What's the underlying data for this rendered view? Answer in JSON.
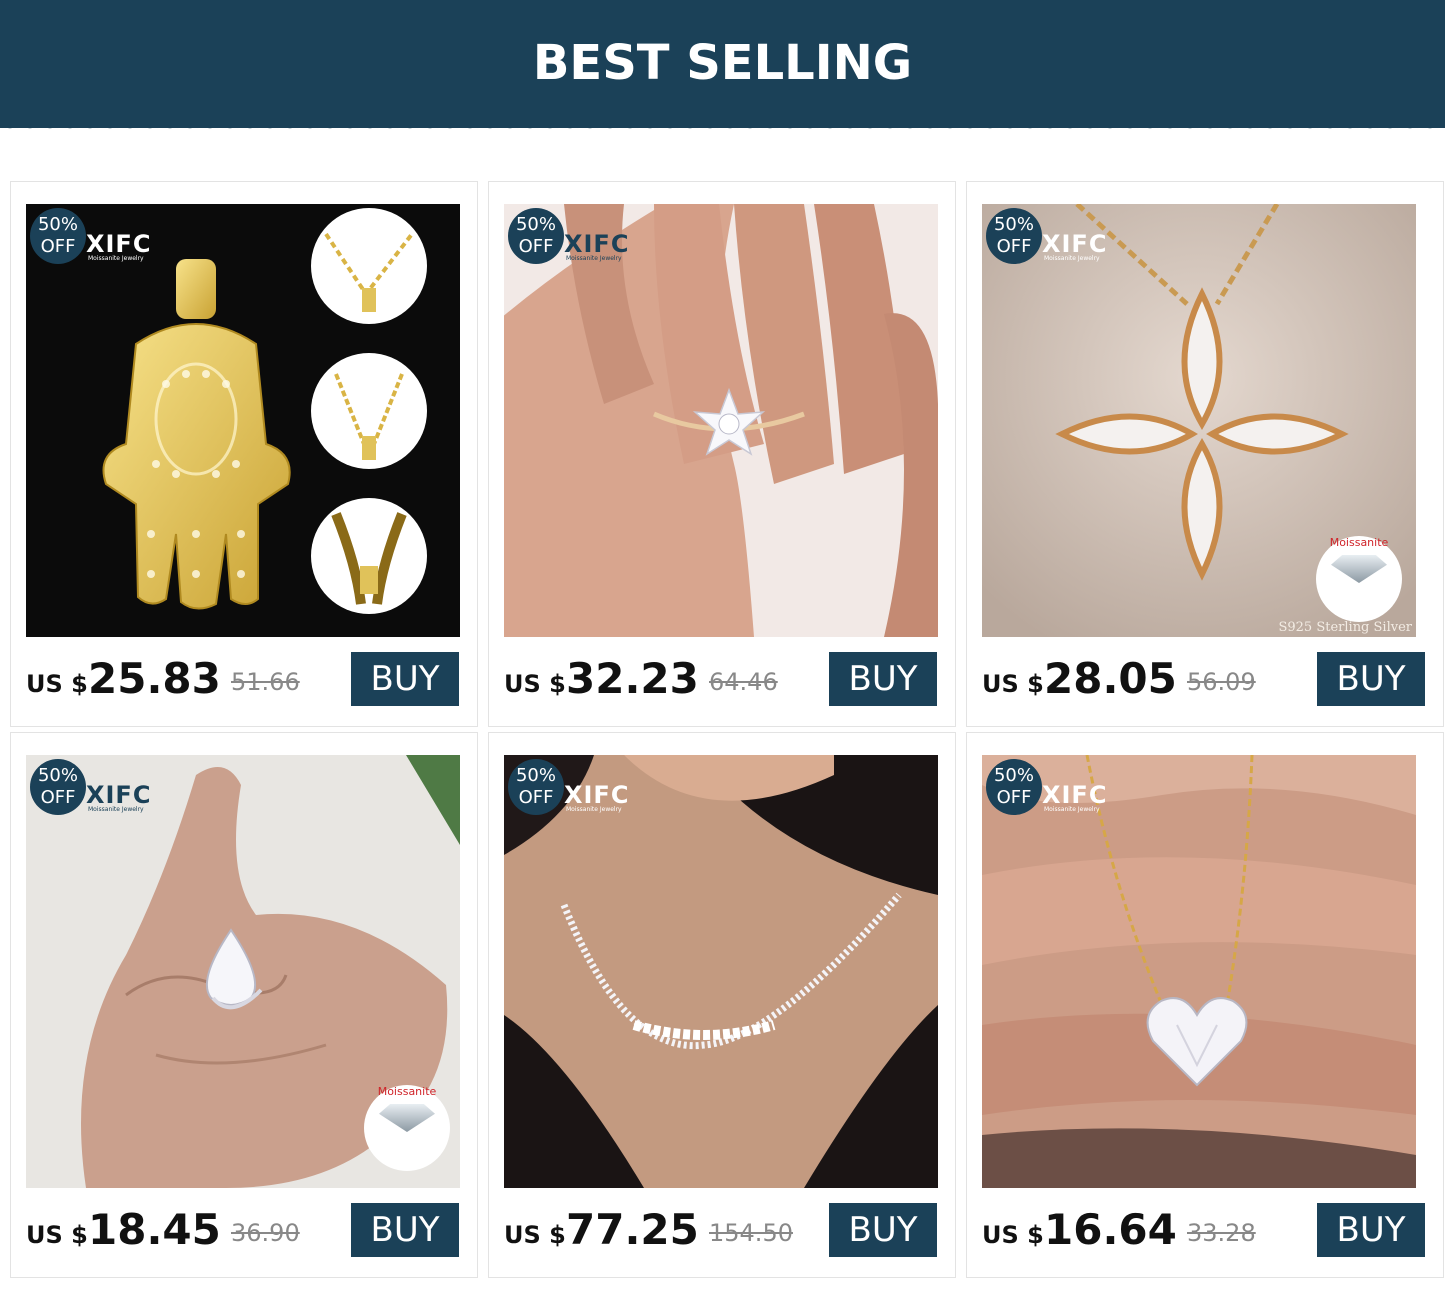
{
  "banner": {
    "title": "BEST SELLING"
  },
  "badge": {
    "line1": "50%",
    "line2": "OFF"
  },
  "brand": {
    "name": "XIFC",
    "tagline": "Moissanite Jewelry"
  },
  "currency": "US $",
  "buy_label": "BUY",
  "products": [
    {
      "price": "25.83",
      "orig": "51.66",
      "kind": "hamsa-pendant"
    },
    {
      "price": "32.23",
      "orig": "64.46",
      "kind": "snowflake-ring"
    },
    {
      "price": "28.05",
      "orig": "56.09",
      "kind": "clover-pendant",
      "moissanite": "Moissanite",
      "sterling": "S925 Sterling Silver"
    },
    {
      "price": "18.45",
      "orig": "36.90",
      "kind": "pear-ring",
      "moissanite": "Moissanite"
    },
    {
      "price": "77.25",
      "orig": "154.50",
      "kind": "tennis-necklace"
    },
    {
      "price": "16.64",
      "orig": "33.28",
      "kind": "heart-pendant"
    }
  ]
}
